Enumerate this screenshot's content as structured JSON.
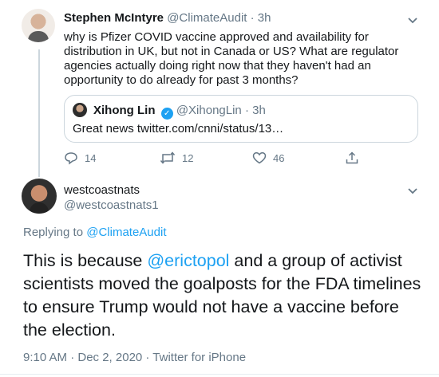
{
  "tweet1": {
    "display_name": "Stephen McIntyre",
    "handle": "@ClimateAudit",
    "time": "· 3h",
    "text": "why is Pfizer COVID vaccine approved and availability for distribution in UK, but not in Canada or US? What are regulator agencies actually doing right now that they haven't had an opportunity to do already for past 3 months?",
    "quote": {
      "display_name": "Xihong Lin",
      "handle": "@XihongLin",
      "time": "· 3h",
      "text": "Great news twitter.com/cnni/status/13…"
    },
    "actions": {
      "replies": "14",
      "retweets": "12",
      "likes": "46"
    }
  },
  "tweet2": {
    "display_name": "westcoastnats",
    "handle": "@westcoastnats1",
    "replying_to_prefix": "Replying to",
    "replying_to_handle": "@ClimateAudit",
    "text_part1": "This is because ",
    "mention": "@erictopol",
    "text_part2": " and a group of activist scientists moved the goalposts for the FDA timelines to ensure Trump would not have a vaccine before the election.",
    "timestamp": "9:10 AM · Dec 2, 2020 · Twitter for iPhone"
  },
  "colors": {
    "link": "#1da1f2",
    "muted": "#657786",
    "border": "#ccd6dd"
  },
  "icons": [
    "chevron-down-icon",
    "reply-icon",
    "retweet-icon",
    "like-icon",
    "share-icon",
    "verified-icon"
  ]
}
